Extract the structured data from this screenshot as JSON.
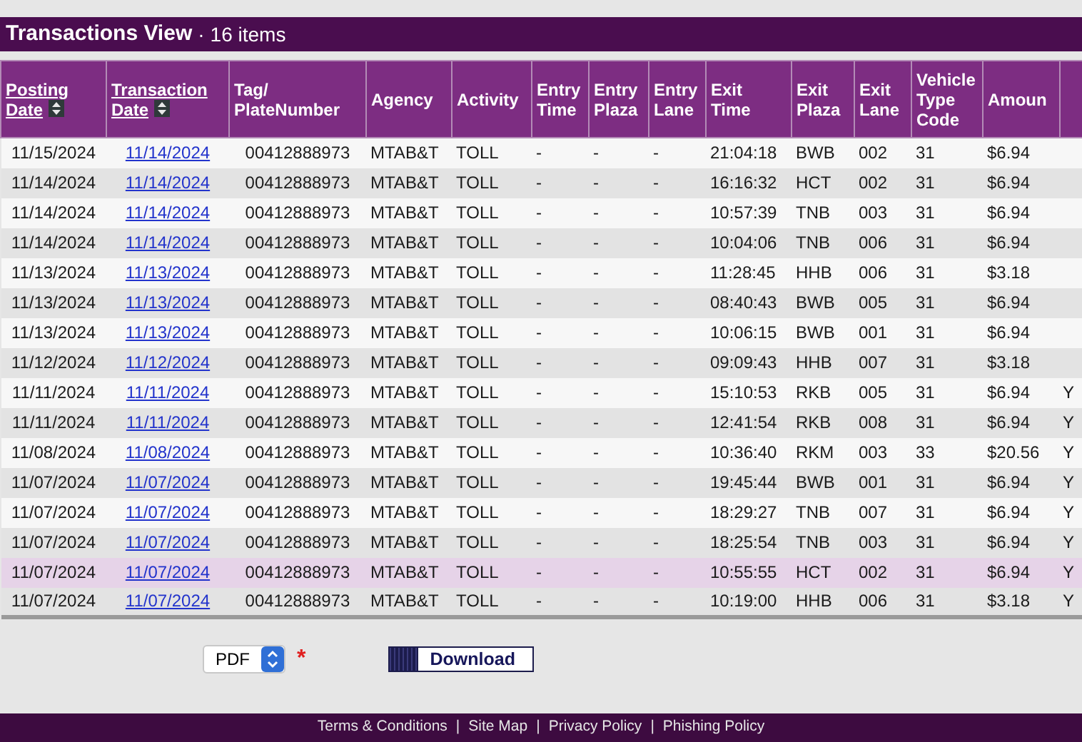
{
  "panel": {
    "title": "Transactions View",
    "separator": "·",
    "count": "16 items"
  },
  "columns": [
    {
      "label": "Posting Date",
      "sortable": true
    },
    {
      "label": "Transaction Date",
      "sortable": true
    },
    {
      "label": "Tag/ PlateNumber",
      "sortable": false
    },
    {
      "label": "Agency",
      "sortable": false
    },
    {
      "label": "Activity",
      "sortable": false
    },
    {
      "label": "Entry Time",
      "sortable": false
    },
    {
      "label": "Entry Plaza",
      "sortable": false
    },
    {
      "label": "Entry Lane",
      "sortable": false
    },
    {
      "label": "Exit Time",
      "sortable": false
    },
    {
      "label": "Exit Plaza",
      "sortable": false
    },
    {
      "label": "Exit Lane",
      "sortable": false
    },
    {
      "label": "Vehicle Type Code",
      "sortable": false
    },
    {
      "label": "Amoun",
      "sortable": false
    }
  ],
  "rows": [
    {
      "selected": false,
      "cells": [
        "11/15/2024",
        "11/14/2024",
        "00412888973",
        "MTAB&T",
        "TOLL",
        "-",
        "-",
        "-",
        "21:04:18",
        "BWB",
        "002",
        "31",
        "$6.94"
      ]
    },
    {
      "selected": false,
      "cells": [
        "11/14/2024",
        "11/14/2024",
        "00412888973",
        "MTAB&T",
        "TOLL",
        "-",
        "-",
        "-",
        "16:16:32",
        "HCT",
        "002",
        "31",
        "$6.94"
      ]
    },
    {
      "selected": false,
      "cells": [
        "11/14/2024",
        "11/14/2024",
        "00412888973",
        "MTAB&T",
        "TOLL",
        "-",
        "-",
        "-",
        "10:57:39",
        "TNB",
        "003",
        "31",
        "$6.94"
      ]
    },
    {
      "selected": false,
      "cells": [
        "11/14/2024",
        "11/14/2024",
        "00412888973",
        "MTAB&T",
        "TOLL",
        "-",
        "-",
        "-",
        "10:04:06",
        "TNB",
        "006",
        "31",
        "$6.94"
      ]
    },
    {
      "selected": false,
      "cells": [
        "11/13/2024",
        "11/13/2024",
        "00412888973",
        "MTAB&T",
        "TOLL",
        "-",
        "-",
        "-",
        "11:28:45",
        "HHB",
        "006",
        "31",
        "$3.18"
      ]
    },
    {
      "selected": false,
      "cells": [
        "11/13/2024",
        "11/13/2024",
        "00412888973",
        "MTAB&T",
        "TOLL",
        "-",
        "-",
        "-",
        "08:40:43",
        "BWB",
        "005",
        "31",
        "$6.94"
      ]
    },
    {
      "selected": false,
      "cells": [
        "11/13/2024",
        "11/13/2024",
        "00412888973",
        "MTAB&T",
        "TOLL",
        "-",
        "-",
        "-",
        "10:06:15",
        "BWB",
        "001",
        "31",
        "$6.94"
      ]
    },
    {
      "selected": false,
      "cells": [
        "11/12/2024",
        "11/12/2024",
        "00412888973",
        "MTAB&T",
        "TOLL",
        "-",
        "-",
        "-",
        "09:09:43",
        "HHB",
        "007",
        "31",
        "$3.18"
      ]
    },
    {
      "selected": false,
      "flag": "Y",
      "cells": [
        "11/11/2024",
        "11/11/2024",
        "00412888973",
        "MTAB&T",
        "TOLL",
        "-",
        "-",
        "-",
        "15:10:53",
        "RKB",
        "005",
        "31",
        "$6.94"
      ]
    },
    {
      "selected": false,
      "flag": "Y",
      "cells": [
        "11/11/2024",
        "11/11/2024",
        "00412888973",
        "MTAB&T",
        "TOLL",
        "-",
        "-",
        "-",
        "12:41:54",
        "RKB",
        "008",
        "31",
        "$6.94"
      ]
    },
    {
      "selected": false,
      "flag": "Y",
      "cells": [
        "11/08/2024",
        "11/08/2024",
        "00412888973",
        "MTAB&T",
        "TOLL",
        "-",
        "-",
        "-",
        "10:36:40",
        "RKM",
        "003",
        "33",
        "$20.56"
      ]
    },
    {
      "selected": false,
      "flag": "Y",
      "cells": [
        "11/07/2024",
        "11/07/2024",
        "00412888973",
        "MTAB&T",
        "TOLL",
        "-",
        "-",
        "-",
        "19:45:44",
        "BWB",
        "001",
        "31",
        "$6.94"
      ]
    },
    {
      "selected": false,
      "flag": "Y",
      "cells": [
        "11/07/2024",
        "11/07/2024",
        "00412888973",
        "MTAB&T",
        "TOLL",
        "-",
        "-",
        "-",
        "18:29:27",
        "TNB",
        "007",
        "31",
        "$6.94"
      ]
    },
    {
      "selected": false,
      "flag": "Y",
      "cells": [
        "11/07/2024",
        "11/07/2024",
        "00412888973",
        "MTAB&T",
        "TOLL",
        "-",
        "-",
        "-",
        "18:25:54",
        "TNB",
        "003",
        "31",
        "$6.94"
      ]
    },
    {
      "selected": true,
      "flag": "Y",
      "cells": [
        "11/07/2024",
        "11/07/2024",
        "00412888973",
        "MTAB&T",
        "TOLL",
        "-",
        "-",
        "-",
        "10:55:55",
        "HCT",
        "002",
        "31",
        "$6.94"
      ]
    },
    {
      "selected": false,
      "flag": "Y",
      "cells": [
        "11/07/2024",
        "11/07/2024",
        "00412888973",
        "MTAB&T",
        "TOLL",
        "-",
        "-",
        "-",
        "10:19:00",
        "HHB",
        "006",
        "31",
        "$3.18"
      ]
    }
  ],
  "export": {
    "format": "PDF",
    "required_mark": "*",
    "button": "Download"
  },
  "footer_links": [
    "Terms & Conditions",
    "|",
    "Site Map",
    "|",
    "Privacy Policy",
    "|",
    "Phishing Policy"
  ]
}
